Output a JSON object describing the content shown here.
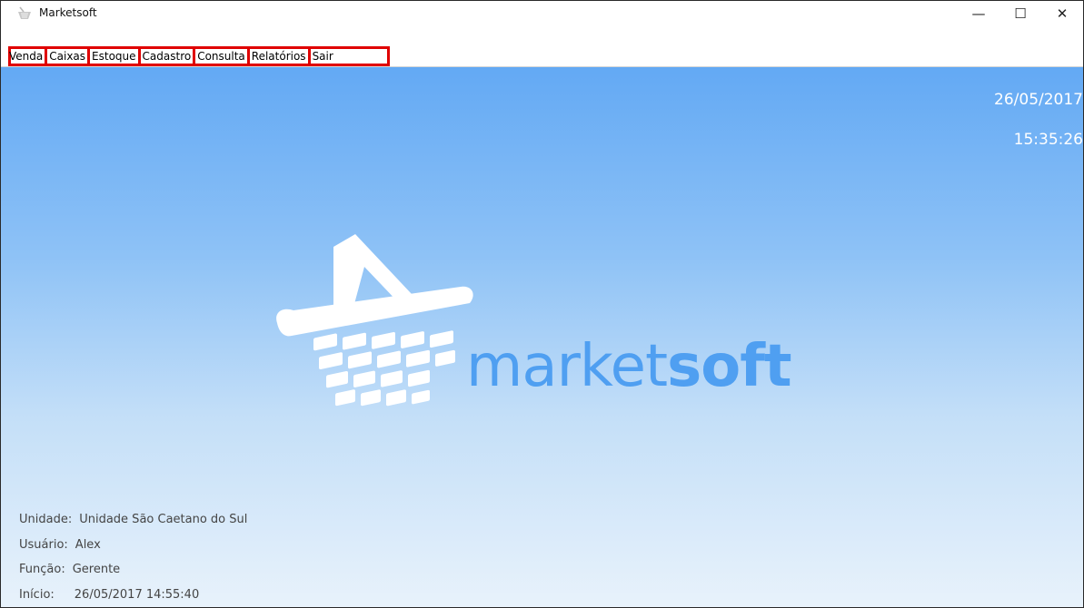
{
  "window": {
    "title": "Marketsoft",
    "controls": {
      "minimize": "—",
      "maximize": "☐",
      "close": "✕"
    }
  },
  "menu": {
    "items": [
      "Venda",
      "Caixas",
      "Estoque",
      "Cadastro",
      "Consulta",
      "Relatórios",
      "Sair"
    ],
    "highlight_color": "#e00000"
  },
  "clock": {
    "date": "26/05/2017",
    "time": "15:35:26"
  },
  "logo": {
    "text_regular": "market",
    "text_bold": "soft",
    "color": "#4f9ff1"
  },
  "session": {
    "unit_label": "Unidade:",
    "unit_value": "Unidade São Caetano do Sul",
    "user_label": "Usuário:",
    "user_value": "Alex",
    "role_label": "Função:",
    "role_value": "Gerente",
    "start_label": "Início:",
    "start_value": "26/05/2017 14:55:40"
  },
  "colors": {
    "background_top": "#63a9f4",
    "background_bottom": "#e8f2fb"
  }
}
